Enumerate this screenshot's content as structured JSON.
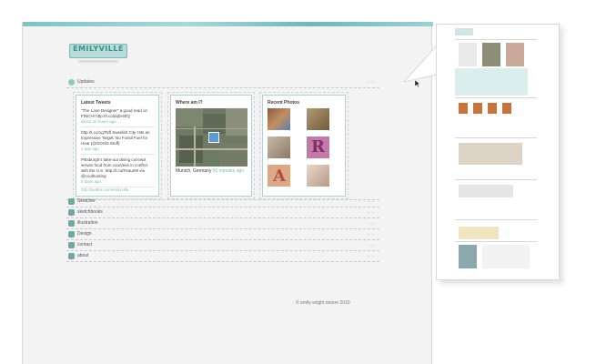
{
  "logo": {
    "text": "EMILYVILLE"
  },
  "updates": {
    "label": "Updates",
    "link": "←←",
    "tweets": {
      "title": "Latest Tweets",
      "items": [
        {
          "text": "\"The Lone Designer\" a good read on FINCH! http://t.co/jSjbH4fQ",
          "date": "about 20 hours ago"
        },
        {
          "text": "http://t.co/1g7l5fl Swedish City Hits an Impressive Target: No Fossil Fuel for Heat (@GOOD Stuff)",
          "date": "1 day ago"
        },
        {
          "text": "Pittsburgh's take-out dining concept serves food from countries in conflict with the U.S. http://t.co/Feaue9t via @coolhunting",
          "date": "5 days ago"
        }
      ],
      "link": "http://twitter.com/emilyville"
    },
    "where": {
      "title": "Where am I?",
      "place": "Munich, Germany",
      "ago": "50 minutes ago"
    },
    "photos": {
      "title": "Recent Photos"
    }
  },
  "sections": [
    {
      "label": "Sketcher",
      "link": "←←"
    },
    {
      "label": "sketchbooks",
      "link": "←←"
    },
    {
      "label": "illustration",
      "link": "←←"
    },
    {
      "label": "Design",
      "link": "←←"
    },
    {
      "label": "contact",
      "link": "←←"
    },
    {
      "label": "about",
      "link": "←←"
    }
  ],
  "footer": {
    "copyright": "© emily wright moore 2010"
  },
  "colors": {
    "accent": "#7bbab5",
    "bar": "#7fc4c1"
  },
  "icons": [
    "cursor-arrow-icon",
    "section-icon"
  ]
}
